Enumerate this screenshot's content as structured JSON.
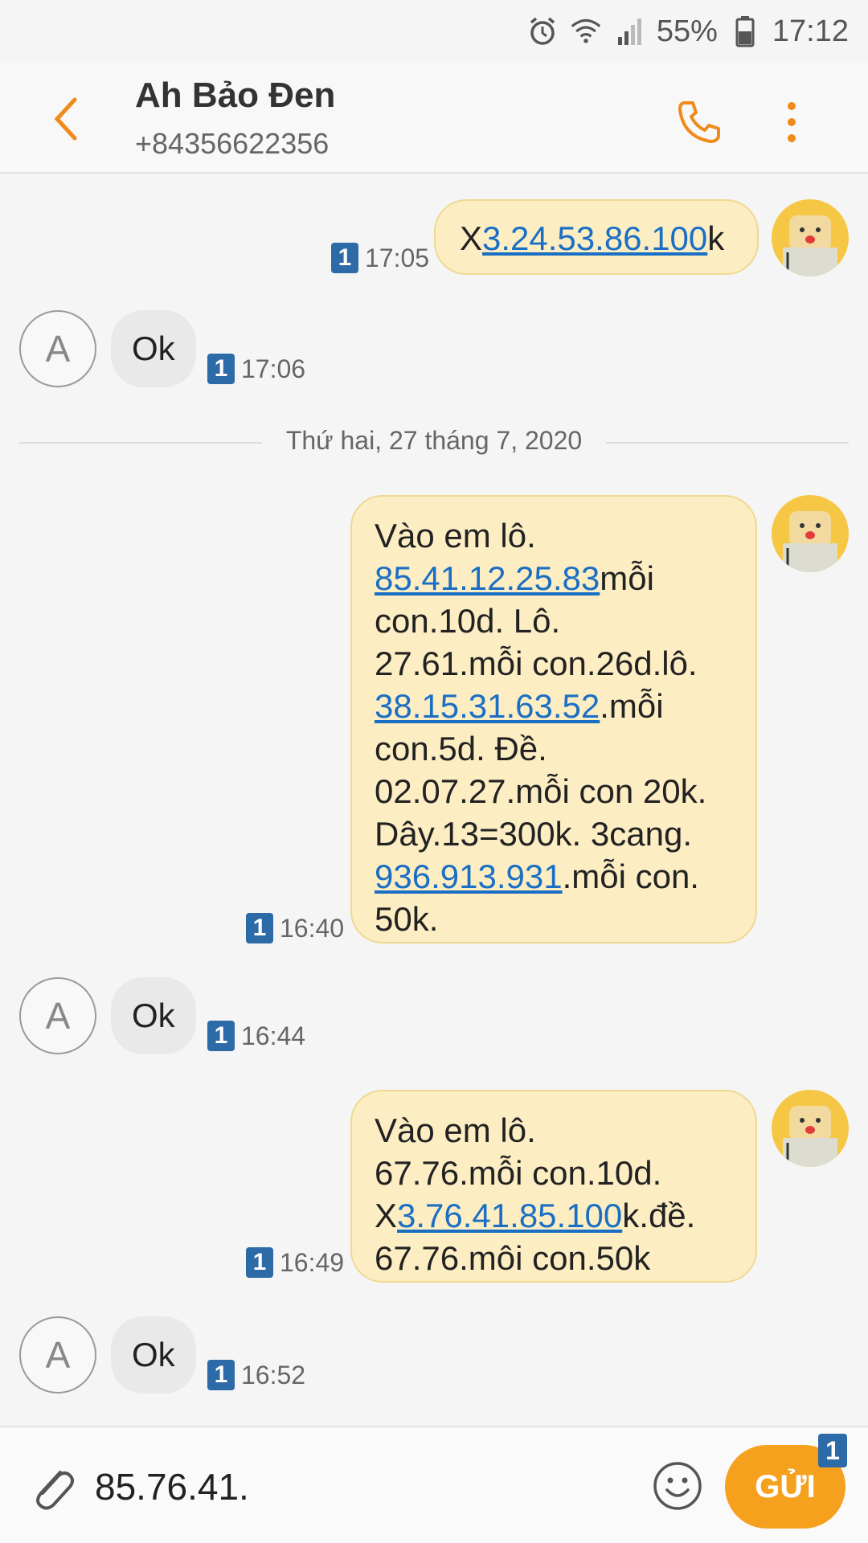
{
  "status_bar": {
    "battery": "55%",
    "time": "17:12",
    "icons": [
      "alarm-icon",
      "wifi-icon",
      "signal-icon",
      "battery-icon"
    ]
  },
  "header": {
    "contact_name": "Ah Bảo Đen",
    "contact_number": "+84356622356",
    "back_icon": "back-arrow-icon",
    "call_icon": "phone-icon",
    "more_icon": "more-vertical-icon",
    "accent_color": "#f08a1c"
  },
  "messages": [
    {
      "direction": "out",
      "time": "17:05",
      "sim": "1",
      "parts": [
        {
          "text": "X",
          "link": false
        },
        {
          "text": "3.24.53.86.100",
          "link": true
        },
        {
          "text": "k",
          "link": false
        }
      ]
    },
    {
      "direction": "in",
      "time": "17:06",
      "sim": "1",
      "avatar": "A",
      "text": "Ok"
    },
    {
      "direction": "out",
      "time": "16:40",
      "sim": "1",
      "lines": [
        [
          {
            "text": "Vào em lô.",
            "link": false
          }
        ],
        [
          {
            "text": "85.41.12.25.83",
            "link": true
          },
          {
            "text": "mỗi",
            "link": false
          }
        ],
        [
          {
            "text": "con.10d. Lô.",
            "link": false
          }
        ],
        [
          {
            "text": "27.61.mỗi con.26d.lô.",
            "link": false
          }
        ],
        [
          {
            "text": "38.15.31.63.52",
            "link": true
          },
          {
            "text": ".mỗi",
            "link": false
          }
        ],
        [
          {
            "text": "con.5d. Đề.",
            "link": false
          }
        ],
        [
          {
            "text": "02.07.27.mỗi con 20k.",
            "link": false
          }
        ],
        [
          {
            "text": "Dây.13=300k. 3cang.",
            "link": false
          }
        ],
        [
          {
            "text": "936.913.931",
            "link": true
          },
          {
            "text": ".mỗi con.",
            "link": false
          }
        ],
        [
          {
            "text": "50k.",
            "link": false
          }
        ]
      ]
    },
    {
      "direction": "in",
      "time": "16:44",
      "sim": "1",
      "avatar": "A",
      "text": "Ok"
    },
    {
      "direction": "out",
      "time": "16:49",
      "sim": "1",
      "lines": [
        [
          {
            "text": "Vào em lô.",
            "link": false
          }
        ],
        [
          {
            "text": "67.76.mỗi con.10d.",
            "link": false
          }
        ],
        [
          {
            "text": "X",
            "link": false
          },
          {
            "text": "3.76.41.85.100",
            "link": true
          },
          {
            "text": "k.đề.",
            "link": false
          }
        ],
        [
          {
            "text": "67.76.môi con.50k",
            "link": false
          }
        ]
      ]
    },
    {
      "direction": "in",
      "time": "16:52",
      "sim": "1",
      "avatar": "A",
      "text": "Ok"
    }
  ],
  "date_separator": "Thứ hai, 27 tháng 7, 2020",
  "composer": {
    "input_value": "85.76.41.",
    "send_label": "GỬI",
    "send_sim_badge": "1",
    "attach_icon": "paperclip-icon",
    "emoji_icon": "emoji-icon",
    "send_color": "#f5a11e"
  },
  "colors": {
    "outgoing_bubble": "#fcedc3",
    "incoming_bubble": "#e9e9e9",
    "link": "#1a6fc5",
    "sim_badge": "#2c6aa8"
  }
}
